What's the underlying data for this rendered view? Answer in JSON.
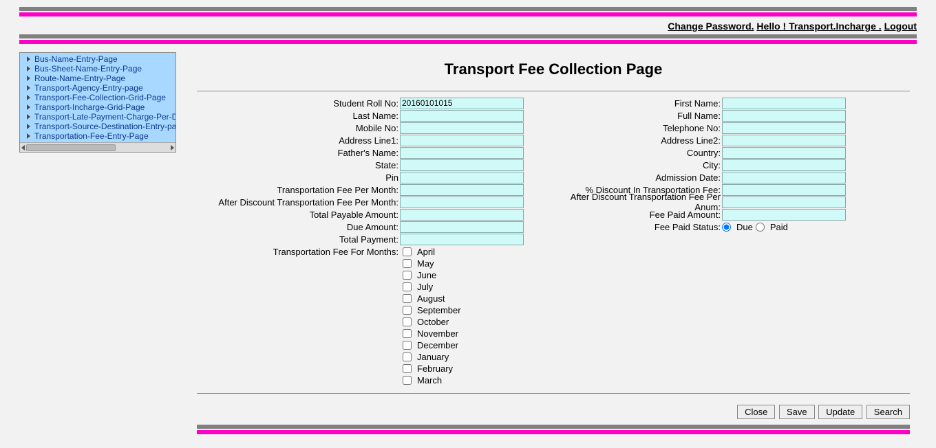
{
  "header": {
    "change_password": "Change Password.",
    "greeting": "Hello ! Transport.Incharge .",
    "logout": "Logout"
  },
  "sidebar": {
    "items": [
      {
        "label": "Bus-Name-Entry-Page"
      },
      {
        "label": "Bus-Sheet-Name-Entry-Page"
      },
      {
        "label": "Route-Name-Entry-Page"
      },
      {
        "label": "Transport-Agency-Entry-page"
      },
      {
        "label": "Transport-Fee-Collection-Grid-Page"
      },
      {
        "label": "Transport-Incharge-Grid-Page"
      },
      {
        "label": "Transport-Late-Payment-Charge-Per-Da"
      },
      {
        "label": "Transport-Source-Destination-Entry-pa"
      },
      {
        "label": "Transportation-Fee-Entry-Page"
      }
    ]
  },
  "page": {
    "title": "Transport Fee Collection Page"
  },
  "labels": {
    "student_roll": "Student Roll No:",
    "first_name": "First Name:",
    "last_name": "Last Name:",
    "full_name": "Full Name:",
    "mobile": "Mobile No:",
    "telephone": "Telephone No:",
    "addr1": "Address Line1:",
    "addr2": "Address Line2:",
    "father": "Father's Name:",
    "country": "Country:",
    "state": "State:",
    "city": "City:",
    "pin": "Pin",
    "admission_date": "Admission Date:",
    "fee_month": "Transportation Fee Per Month:",
    "discount_pct": "% Discount In Transportation Fee:",
    "after_disc_month": "After Discount Transportation Fee Per Month:",
    "after_disc_annum": "After Discount Transportation Fee Per Anum:",
    "total_payable": "Total Payable Amount:",
    "fee_paid_amount": "Fee Paid Amount:",
    "due_amount": "Due Amount:",
    "fee_paid_status": "Fee Paid Status:",
    "total_payment": "Total Payment:",
    "months": "Transportation Fee For Months:"
  },
  "values": {
    "student_roll": "20160101015",
    "first_name": "",
    "last_name": "",
    "full_name": "",
    "mobile": "",
    "telephone": "",
    "addr1": "",
    "addr2": "",
    "father": "",
    "country": "",
    "state": "",
    "city": "",
    "pin": "",
    "admission_date": "",
    "fee_month": "",
    "discount_pct": "",
    "after_disc_month": "",
    "after_disc_annum": "",
    "total_payable": "",
    "fee_paid_amount": "",
    "due_amount": "",
    "total_payment": ""
  },
  "status": {
    "due_label": "Due",
    "paid_label": "Paid",
    "selected": "Due"
  },
  "months_list": [
    "April",
    "May",
    "June",
    "July",
    "August",
    "September",
    "October",
    "November",
    "December",
    "January",
    "February",
    "March"
  ],
  "buttons": {
    "close": "Close",
    "save": "Save",
    "update": "Update",
    "search": "Search"
  }
}
